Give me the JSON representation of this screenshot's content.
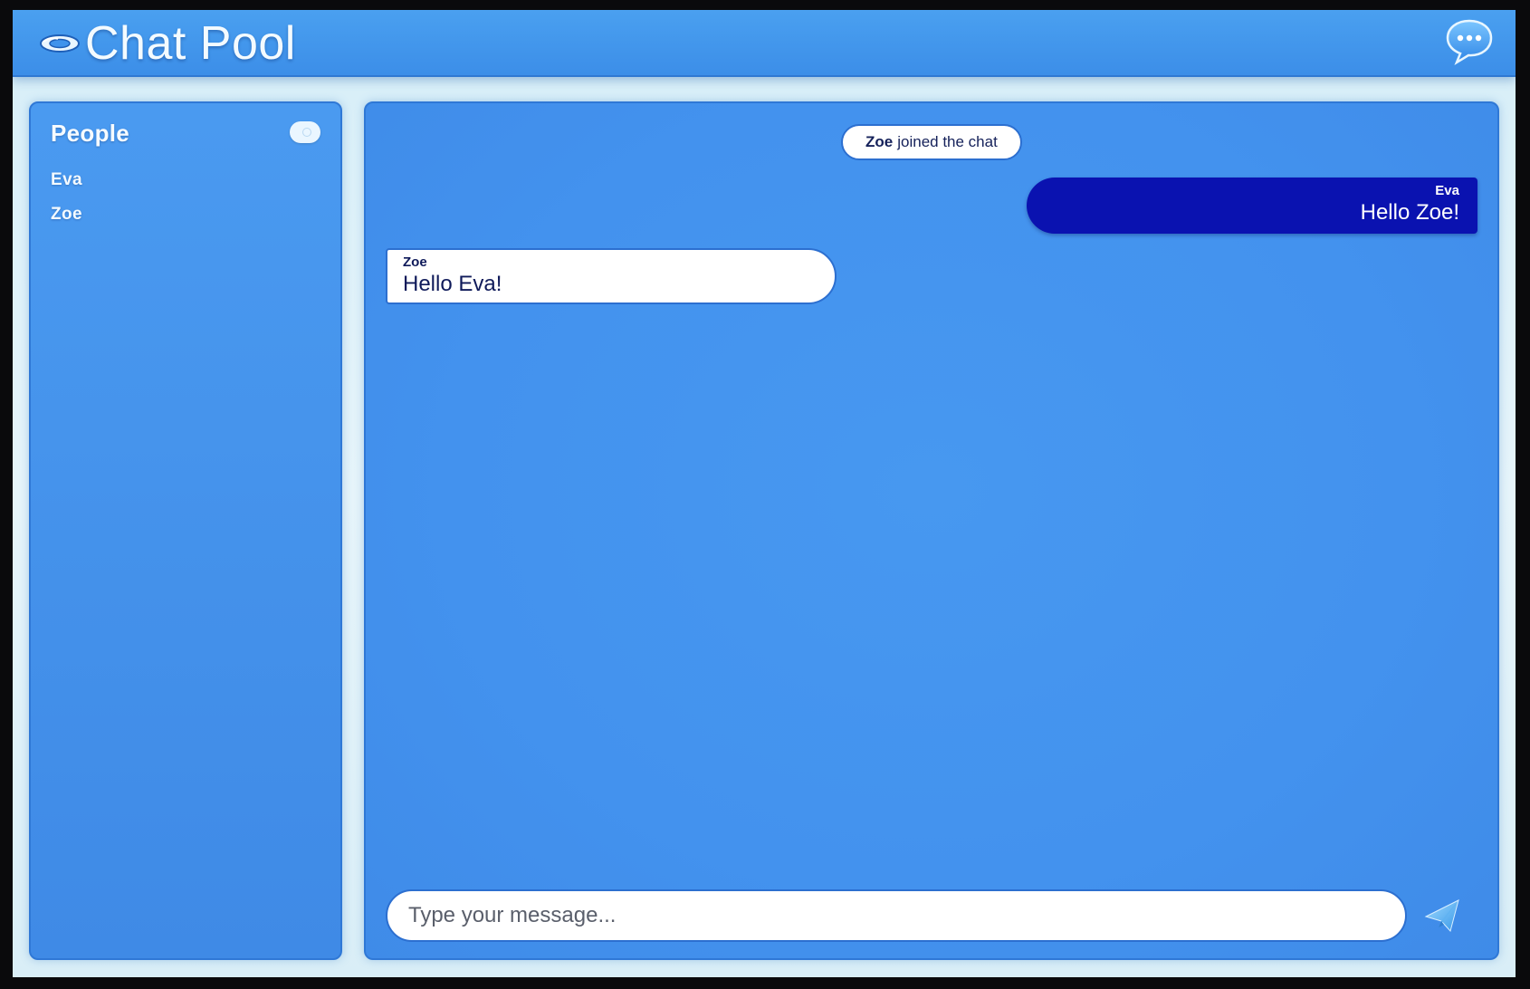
{
  "header": {
    "title": "Chat Pool",
    "logo_icon": "pool-float-logo-icon",
    "chat_icon": "chat-bubble-dots-icon"
  },
  "sidebar": {
    "title": "People",
    "toggle_icon": "toggle-icon",
    "people": [
      {
        "name": "Eva"
      },
      {
        "name": "Zoe"
      }
    ]
  },
  "chat": {
    "system_message": {
      "name": "Zoe",
      "text": "joined the chat"
    },
    "messages": [
      {
        "author": "Eva",
        "text": "Hello Zoe!",
        "direction": "outgoing"
      },
      {
        "author": "Zoe",
        "text": "Hello Eva!",
        "direction": "incoming"
      }
    ],
    "composer": {
      "placeholder": "Type your message...",
      "value": ""
    },
    "send_icon": "paper-plane-send-icon"
  },
  "colors": {
    "header": "#3f93ec",
    "panel": "#4392ee",
    "outgoing_bubble": "#0a12b0",
    "incoming_bubble": "#ffffff",
    "frame": "#d6eef8"
  }
}
